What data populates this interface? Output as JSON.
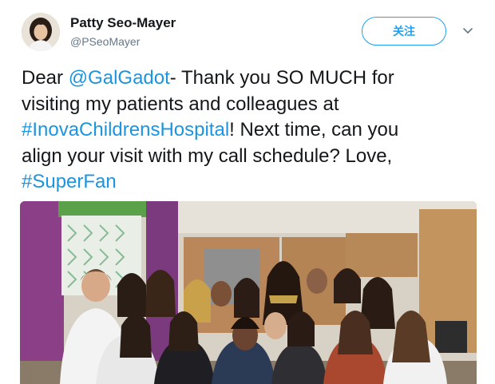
{
  "user": {
    "display_name": "Patty Seo-Mayer",
    "handle": "@PSeoMayer",
    "avatar_icon": "profile-photo"
  },
  "follow": {
    "label": "关注",
    "color": "#1da1f2"
  },
  "menu": {
    "icon": "chevron-down-icon"
  },
  "tweet": {
    "link_color": "#1b95e0",
    "lines": [
      {
        "pre": "Dear ",
        "link": "@GalGadot",
        "post": "- Thank you SO MUCH for"
      },
      {
        "pre": "visiting my patients and colleagues at",
        "link": "",
        "post": ""
      },
      {
        "pre": "",
        "link": "#InovaChildrensHospital",
        "post": "! Next time, can you"
      },
      {
        "pre": "align your visit with my call schedule? Love,",
        "link": "",
        "post": ""
      },
      {
        "pre": "",
        "link": "#SuperFan",
        "post": ""
      }
    ]
  },
  "media": {
    "description_icon": "group-photo"
  }
}
